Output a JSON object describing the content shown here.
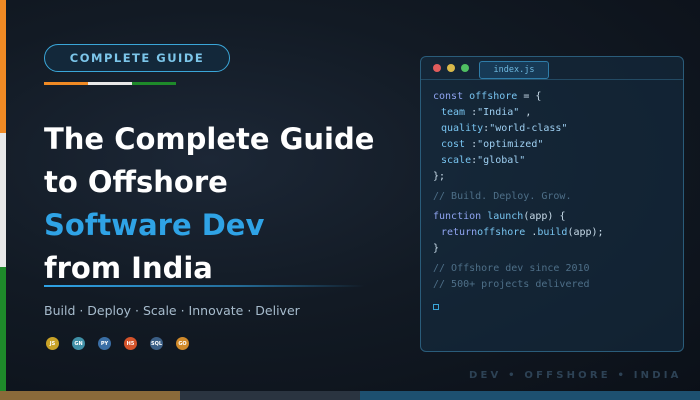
{
  "badge": {
    "label": "COMPLETE GUIDE"
  },
  "headline": {
    "line1": "The Complete Guide",
    "line2": "to Offshore",
    "line3": "Software Dev",
    "line4": "from India"
  },
  "tagline": "Build · Deploy · Scale · Innovate · Deliver",
  "tech_icons": [
    {
      "label": "JS",
      "icon": "js-icon",
      "color": "#c9a227"
    },
    {
      "label": "GN",
      "icon": "go-icon",
      "color": "#3f8fa6"
    },
    {
      "label": "PY",
      "icon": "python-icon",
      "color": "#3a6ea5"
    },
    {
      "label": "H5",
      "icon": "html5-icon",
      "color": "#d4532a"
    },
    {
      "label": "SQL",
      "icon": "sql-icon",
      "color": "#3b5f86"
    },
    {
      "label": "GO",
      "icon": "golang-icon",
      "color": "#d08a2a"
    }
  ],
  "editor": {
    "tab": "index.js",
    "lines": {
      "l1_kw": "const",
      "l1_id": "offshore",
      "l1_rest": " = {",
      "l2_key": "team",
      "l2_colon": " :",
      "l2_val": "\"India\"",
      "l2_end": " ,",
      "l3_key": "quality",
      "l3_colon": ":",
      "l3_val": "\"world-class\"",
      "l4_key": "cost",
      "l4_colon": " :",
      "l4_val": "\"optimized\"",
      "l5_key": "scale",
      "l5_colon": ":",
      "l5_val": "\"global\"",
      "l6": "};",
      "c1": "// Build. Deploy. Grow.",
      "l7_kw": "function",
      "l7_id": "launch",
      "l7_rest": "(app) {",
      "l8_kw": "return",
      "l8_id": "offshore",
      "l8_dot": " .",
      "l8_fn": "build",
      "l8_rest": "(app);",
      "l9": "}",
      "c2": "// Offshore dev since 2010",
      "c3": "// 500+ projects delivered"
    }
  },
  "footer_tag": "DEV • OFFSHORE • INDIA",
  "colors": {
    "accent": "#2fa3e6",
    "flag_orange": "#f08a24",
    "flag_white": "#e8e8e8",
    "flag_green": "#1e8a2a"
  }
}
